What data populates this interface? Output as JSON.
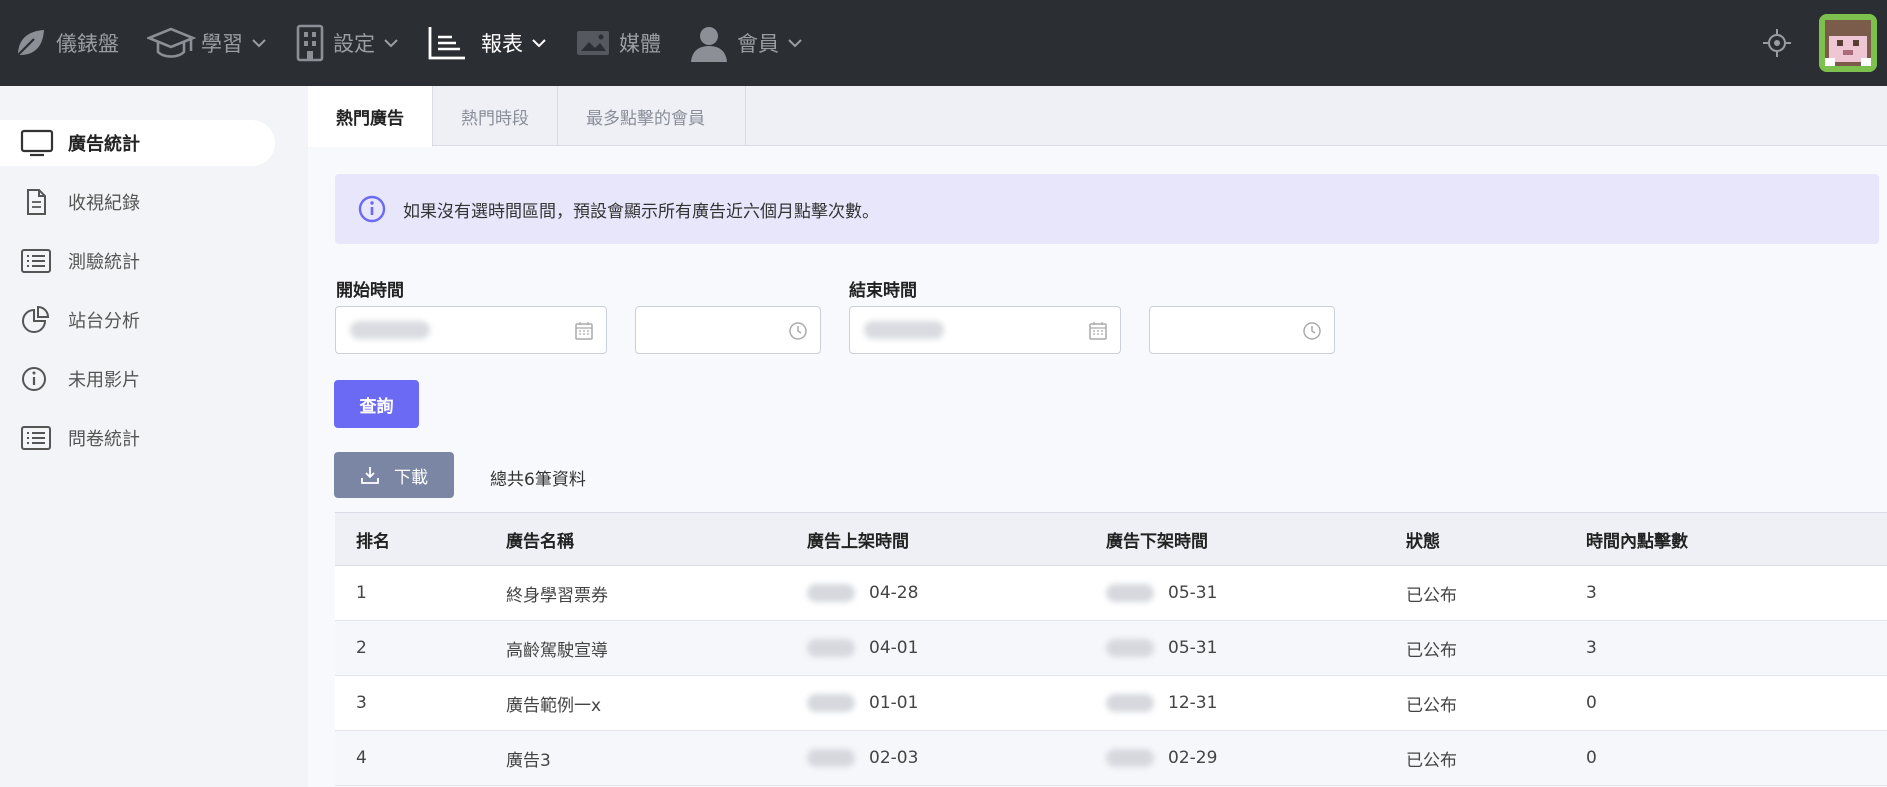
{
  "nav": {
    "items": [
      {
        "label": "儀錶盤",
        "icon": "leaf-icon",
        "dropdown": false,
        "active": false
      },
      {
        "label": "學習",
        "icon": "graduation-cap-icon",
        "dropdown": true,
        "active": false
      },
      {
        "label": "設定",
        "icon": "building-icon",
        "dropdown": true,
        "active": false
      },
      {
        "label": "報表",
        "icon": "report-chart-icon",
        "dropdown": true,
        "active": true
      },
      {
        "label": "媒體",
        "icon": "image-icon",
        "dropdown": false,
        "active": false
      },
      {
        "label": "會員",
        "icon": "user-icon",
        "dropdown": true,
        "active": false
      }
    ]
  },
  "sidebar": {
    "items": [
      {
        "label": "廣告統計",
        "icon": "monitor-icon",
        "active": true
      },
      {
        "label": "收視紀錄",
        "icon": "document-icon",
        "active": false
      },
      {
        "label": "測驗統計",
        "icon": "list-icon",
        "active": false
      },
      {
        "label": "站台分析",
        "icon": "pie-chart-icon",
        "active": false
      },
      {
        "label": "未用影片",
        "icon": "info-icon",
        "active": false
      },
      {
        "label": "問卷統計",
        "icon": "list-icon",
        "active": false
      }
    ]
  },
  "tabs": [
    {
      "label": "熱門廣告",
      "active": true
    },
    {
      "label": "熱門時段",
      "active": false
    },
    {
      "label": "最多點擊的會員",
      "active": false
    }
  ],
  "alert": {
    "text": "如果沒有選時間區間，預設會顯示所有廣告近六個月點擊次數。"
  },
  "form": {
    "start_label": "開始時間",
    "end_label": "結束時間",
    "query_button": "查詢"
  },
  "download_button": "下載",
  "total_text": "總共6筆資料",
  "table": {
    "headers": [
      "排名",
      "廣告名稱",
      "廣告上架時間",
      "廣告下架時間",
      "狀態",
      "時間內點擊數"
    ],
    "rows": [
      {
        "rank": "1",
        "name": "終身學習票券",
        "start": "04-28",
        "end": "05-31",
        "status": "已公布",
        "clicks": "3"
      },
      {
        "rank": "2",
        "name": "高齡駕駛宣導",
        "start": "04-01",
        "end": "05-31",
        "status": "已公布",
        "clicks": "3"
      },
      {
        "rank": "3",
        "name": "廣告範例一x",
        "start": "01-01",
        "end": "12-31",
        "status": "已公布",
        "clicks": "0"
      },
      {
        "rank": "4",
        "name": "廣告3",
        "start": "02-03",
        "end": "02-29",
        "status": "已公布",
        "clicks": "0"
      }
    ]
  },
  "colors": {
    "nav_bg": "#2b2e33",
    "primary": "#6b6af5",
    "download": "#7b86a4",
    "alert_bg": "#e8e6fb"
  }
}
